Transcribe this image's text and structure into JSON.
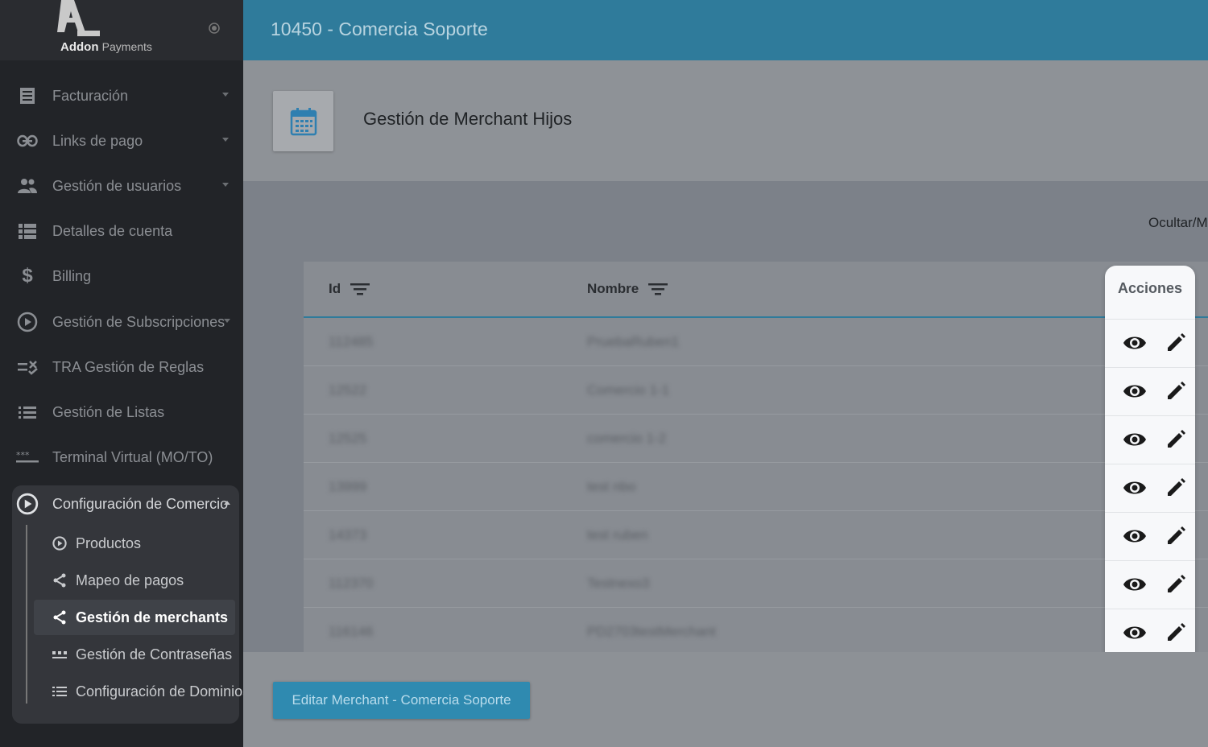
{
  "app": {
    "brand_bold": "Addon",
    "brand_light": "Payments"
  },
  "sidebar": {
    "items": [
      {
        "label": "Facturación",
        "icon": "receipt-icon",
        "has_caret": true
      },
      {
        "label": "Links de pago",
        "icon": "link-icon",
        "has_caret": true
      },
      {
        "label": "Gestión de usuarios",
        "icon": "users-icon",
        "has_caret": true
      },
      {
        "label": "Detalles de cuenta",
        "icon": "list-detail-icon",
        "has_caret": false
      },
      {
        "label": "Billing",
        "icon": "dollar-icon",
        "has_caret": false
      },
      {
        "label": "Gestión de Subscripciones",
        "icon": "play-circle-icon",
        "has_caret": true
      },
      {
        "label": "TRA Gestión de Reglas",
        "icon": "rules-icon",
        "has_caret": false
      },
      {
        "label": "Gestión de Listas",
        "icon": "list-icon",
        "has_caret": false
      },
      {
        "label": "Terminal Virtual (MO/TO)",
        "icon": "password-dots-icon",
        "has_caret": false
      }
    ],
    "config": {
      "label": "Configuración de Comercio",
      "icon": "play-circle-icon",
      "subitems": [
        {
          "label": "Productos",
          "icon": "play-circle-icon",
          "active": false
        },
        {
          "label": "Mapeo de pagos",
          "icon": "share-icon",
          "active": false
        },
        {
          "label": "Gestión de merchants",
          "icon": "share-icon",
          "active": true
        },
        {
          "label": "Gestión de Contraseñas",
          "icon": "password-dots-icon",
          "active": false
        },
        {
          "label": "Configuración de Dominios",
          "icon": "list-icon",
          "active": false
        }
      ]
    }
  },
  "header": {
    "title": "10450 - Comercia Soporte"
  },
  "page": {
    "title": "Gestión de Merchant Hijos",
    "icon": "calendar-icon",
    "toggle_columns": "Ocultar/M"
  },
  "table": {
    "columns": [
      "Id",
      "Nombre",
      "Acciones"
    ],
    "rows": [
      {
        "id": "112485",
        "nombre": "PruebaRuben1"
      },
      {
        "id": "12522",
        "nombre": "Comercio 1-1"
      },
      {
        "id": "12525",
        "nombre": "comercio 1-2"
      },
      {
        "id": "13999",
        "nombre": "test nbo"
      },
      {
        "id": "14373",
        "nombre": "test ruben"
      },
      {
        "id": "112370",
        "nombre": "Testnexo3"
      },
      {
        "id": "116146",
        "nombre": "PD2703testMerchant"
      }
    ]
  },
  "footer": {
    "edit_button": "Editar Merchant - Comercia Soporte"
  },
  "colors": {
    "accent": "#2f7b9b",
    "sidebar_bg": "#222428",
    "button": "#2f8ab0"
  }
}
